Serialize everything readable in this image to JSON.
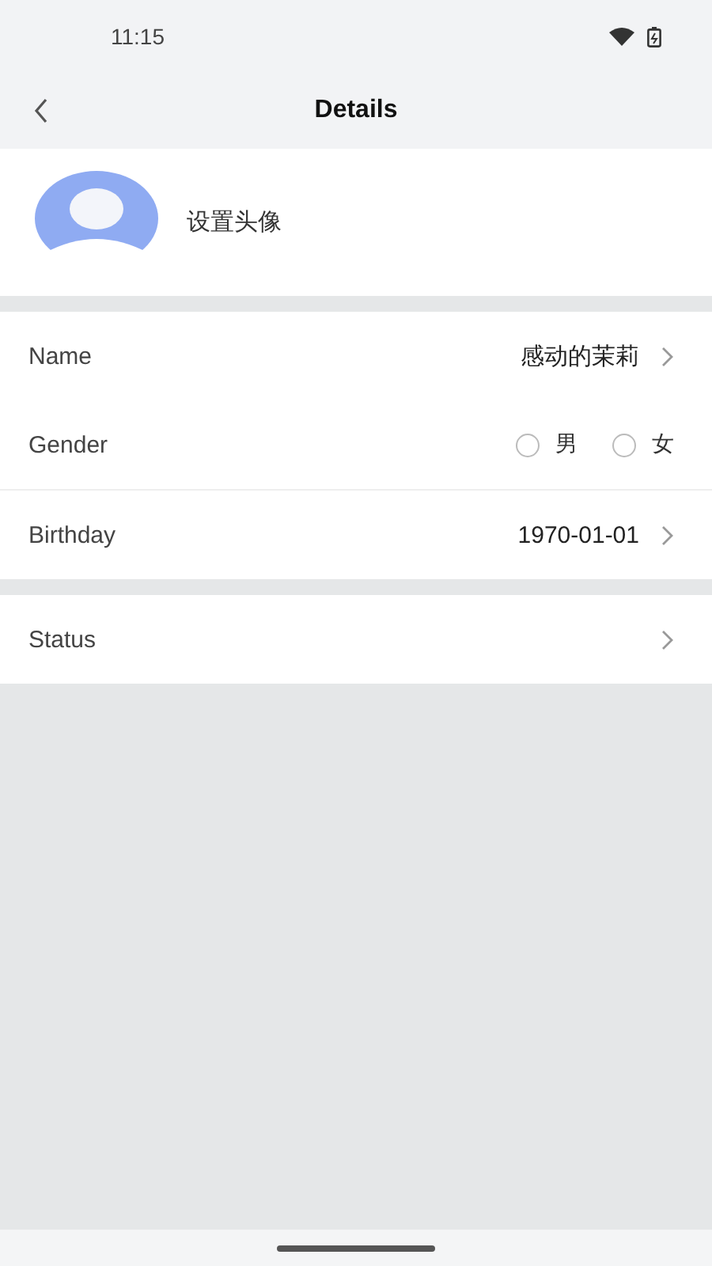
{
  "status_bar": {
    "time": "11:15"
  },
  "header": {
    "title": "Details"
  },
  "avatar": {
    "label": "设置头像"
  },
  "sections": [
    {
      "rows": [
        {
          "kind": "link",
          "label": "Name",
          "value": "感动的茉莉",
          "divider": false
        },
        {
          "kind": "radio",
          "label": "Gender",
          "options": [
            {
              "label": "男",
              "selected": false
            },
            {
              "label": "女",
              "selected": false
            }
          ],
          "divider": true
        },
        {
          "kind": "link",
          "label": "Birthday",
          "value": "1970-01-01",
          "divider": false
        }
      ]
    },
    {
      "rows": [
        {
          "kind": "link",
          "label": "Status",
          "divider": false
        }
      ]
    }
  ]
}
